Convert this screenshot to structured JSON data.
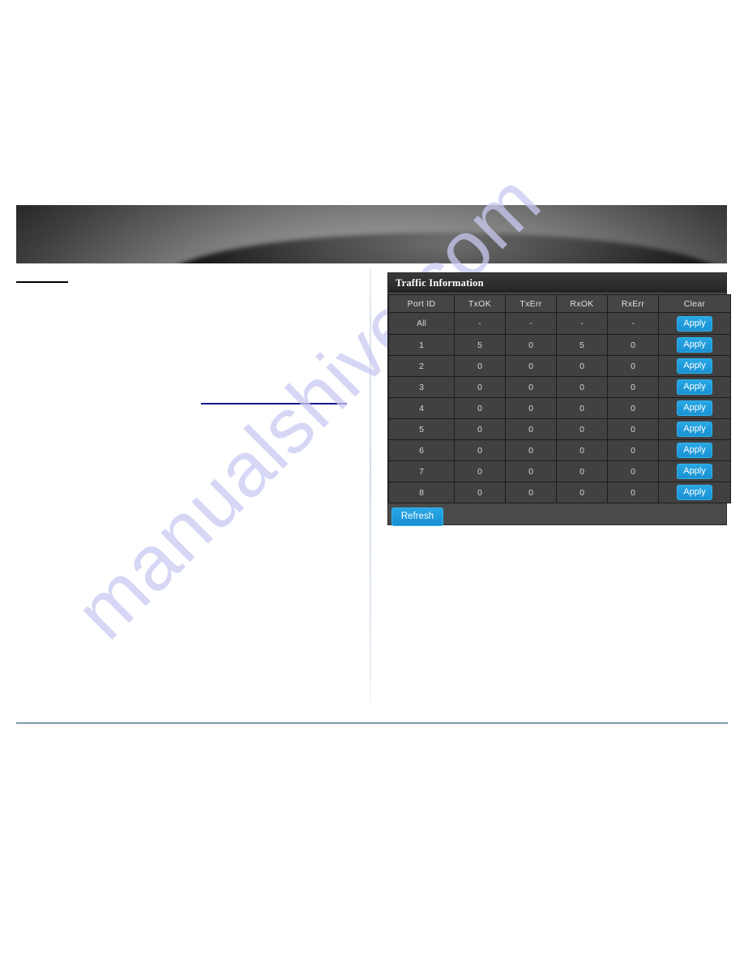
{
  "page": {
    "background_color": "#ffffff",
    "watermark_text": "manualshive.com",
    "watermark_color": "#c9c9f2"
  },
  "banner": {
    "name": "product-banner-image",
    "background_color": "#000000",
    "highlight_color": "#cfcfcf"
  },
  "rules": {
    "top_left_color": "#000000",
    "link_rule_color": "#1a1a8c",
    "footer_rule_color": "#7e9aab",
    "column_divider_color": "#d3dee8"
  },
  "panel": {
    "title": "Traffic Information",
    "accent_color": "#1f9bdb",
    "title_bar_color": "#2e2e2e",
    "body_color": "#4a4a4a",
    "refresh_label": "Refresh"
  },
  "table": {
    "columns": [
      "Port ID",
      "TxOK",
      "TxErr",
      "RxOK",
      "RxErr",
      "Clear"
    ],
    "rows": [
      {
        "port": "All",
        "txok": "-",
        "txerr": "-",
        "rxok": "-",
        "rxerr": "-",
        "clear_label": "Apply"
      },
      {
        "port": "1",
        "txok": "5",
        "txerr": "0",
        "rxok": "5",
        "rxerr": "0",
        "clear_label": "Apply"
      },
      {
        "port": "2",
        "txok": "0",
        "txerr": "0",
        "rxok": "0",
        "rxerr": "0",
        "clear_label": "Apply"
      },
      {
        "port": "3",
        "txok": "0",
        "txerr": "0",
        "rxok": "0",
        "rxerr": "0",
        "clear_label": "Apply"
      },
      {
        "port": "4",
        "txok": "0",
        "txerr": "0",
        "rxok": "0",
        "rxerr": "0",
        "clear_label": "Apply"
      },
      {
        "port": "5",
        "txok": "0",
        "txerr": "0",
        "rxok": "0",
        "rxerr": "0",
        "clear_label": "Apply"
      },
      {
        "port": "6",
        "txok": "0",
        "txerr": "0",
        "rxok": "0",
        "rxerr": "0",
        "clear_label": "Apply"
      },
      {
        "port": "7",
        "txok": "0",
        "txerr": "0",
        "rxok": "0",
        "rxerr": "0",
        "clear_label": "Apply"
      },
      {
        "port": "8",
        "txok": "0",
        "txerr": "0",
        "rxok": "0",
        "rxerr": "0",
        "clear_label": "Apply"
      }
    ]
  }
}
